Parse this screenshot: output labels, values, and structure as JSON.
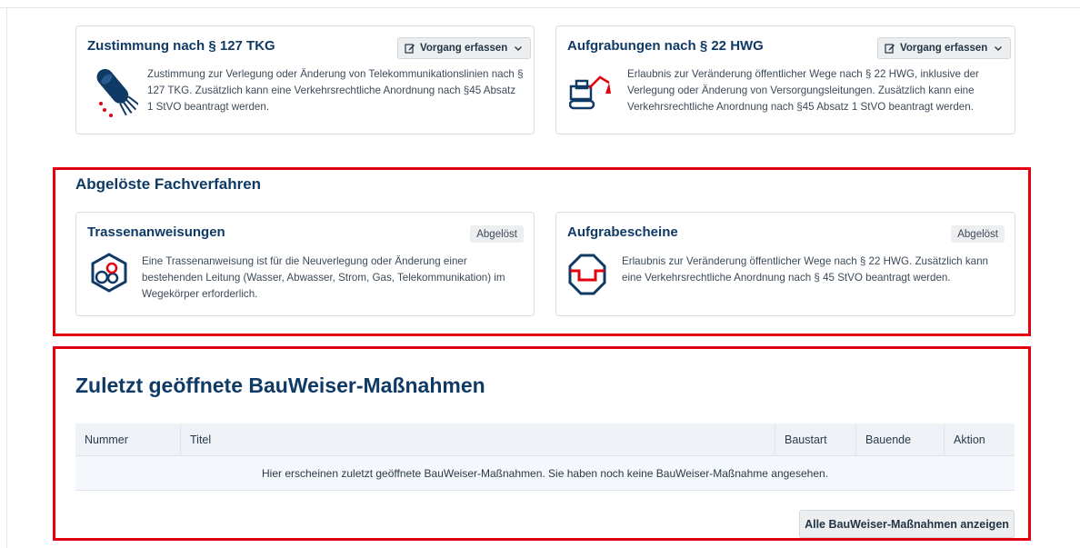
{
  "cards_top": [
    {
      "title": "Zustimmung nach § 127 TKG",
      "button": "Vorgang erfassen",
      "icon": "fiber-cable-icon",
      "text": "Zustimmung zur Verlegung oder Änderung von Telekommunikationslinien nach § 127 TKG. Zusätzlich kann eine Verkehrsrechtliche Anordnung nach §45 Absatz 1 StVO beantragt werden."
    },
    {
      "title": "Aufgrabungen nach § 22 HWG",
      "button": "Vorgang erfassen",
      "icon": "excavator-icon",
      "text": "Erlaubnis zur Veränderung öffentlicher Wege nach § 22 HWG, inklusive der Verlegung oder Änderung von Versorgungsleitungen. Zusätzlich kann eine Verkehrsrechtliche Anordnung nach §45 Absatz 1 StVO beantragt werden."
    }
  ],
  "replaced": {
    "heading": "Abgelöste Fachverfahren",
    "cards": [
      {
        "title": "Trassenanweisungen",
        "badge": "Abgelöst",
        "icon": "pipes-icon",
        "text": "Eine Trassenanweisung ist für die Neuverlegung oder Änderung einer bestehenden Leitung (Wasser, Abwasser, Strom, Gas, Telekommunikation) im Wegekörper erforderlich."
      },
      {
        "title": "Aufgrabescheine",
        "badge": "Abgelöst",
        "icon": "dig-hole-icon",
        "text": "Erlaubnis zur Veränderung öffentlicher Wege nach § 22 HWG. Zusätzlich kann eine Verkehrsrechtliche Anordnung nach § 45 StVO beantragt werden."
      }
    ]
  },
  "recent": {
    "heading": "Zuletzt geöffnete BauWeiser-Maßnahmen",
    "columns": [
      "Nummer",
      "Titel",
      "Baustart",
      "Bauende",
      "Aktion"
    ],
    "empty_text": "Hier erscheinen zuletzt geöffnete BauWeiser-Maßnahmen. Sie haben noch keine BauWeiser-Maßnahme angesehen.",
    "show_all_label": "Alle BauWeiser-Maßnahmen anzeigen"
  },
  "colors": {
    "heading_blue": "#0f3a66",
    "highlight_red": "#e2000f",
    "icon_red": "#e2000f",
    "icon_dark": "#0f3a66"
  }
}
